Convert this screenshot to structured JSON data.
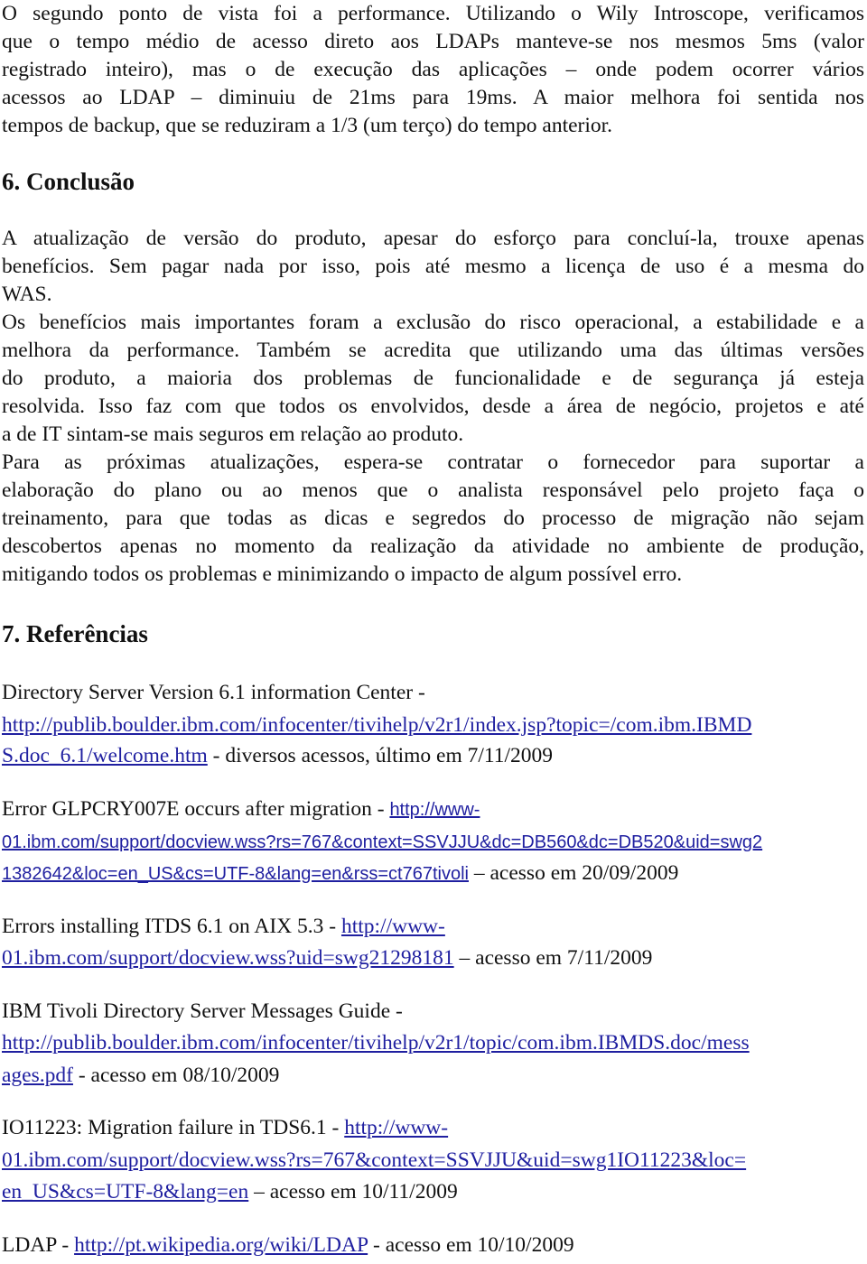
{
  "paragraph_performance": {
    "lines": [
      "O segundo ponto de vista foi a performance. Utilizando o Wily Introscope, verificamos",
      "que o tempo médio de acesso direto aos LDAPs manteve-se nos mesmos 5ms (valor",
      "registrado inteiro), mas o de execução das aplicações – onde podem ocorrer vários",
      "acessos ao LDAP – diminuiu de 21ms para 19ms. A maior melhora foi sentida nos",
      "tempos de backup, que se reduziram a 1/3 (um terço) do tempo anterior."
    ]
  },
  "section6": {
    "heading": "6. Conclusão",
    "p1_lines": [
      "A atualização de versão do produto, apesar do esforço para concluí-la, trouxe apenas",
      "benefícios. Sem pagar nada por isso, pois até mesmo a licença de uso é a mesma do",
      "WAS."
    ],
    "p2_lines": [
      "Os benefícios mais importantes foram a exclusão do risco operacional, a estabilidade e a",
      "melhora da performance. Também se acredita que utilizando uma das últimas versões",
      "do produto, a maioria dos problemas de funcionalidade e de segurança já esteja",
      "resolvida. Isso faz com que todos os envolvidos, desde a área de negócio, projetos e até",
      "a de IT sintam-se mais seguros em relação ao produto."
    ],
    "p3_lines": [
      "Para as próximas atualizações, espera-se contratar o fornecedor para suportar a",
      "elaboração do plano ou ao menos que o analista responsável pelo projeto faça o",
      "treinamento, para que todas as dicas e segredos do processo de migração não sejam",
      "descobertos apenas no momento da realização da atividade no ambiente de produção,",
      "mitigando todos os problemas e minimizando o impacto de algum possível erro."
    ]
  },
  "section7": {
    "heading": "7.  Referências",
    "references": [
      {
        "title": "Directory Server Version 6.1 information Center -",
        "link_line1": "http://publib.boulder.ibm.com/infocenter/tivihelp/v2r1/index.jsp?topic=/com.ibm.IBMD",
        "link_line2": "S.doc_6.1/welcome.htm",
        "suffix": " - diversos acessos, último em 7/11/2009"
      },
      {
        "title": "Error GLPCRY007E occurs after migration - ",
        "link_line1": "http://www-",
        "link_line2": "01.ibm.com/support/docview.wss?rs=767&context=SSVJJU&dc=DB560&dc=DB520&uid=swg2",
        "link_line3": "1382642&loc=en_US&cs=UTF-8&lang=en&rss=ct767tivoli",
        "suffix": " – acesso em 20/09/2009"
      },
      {
        "title": "Errors installing ITDS 6.1 on AIX 5.3 - ",
        "link_line1": "http://www-",
        "link_line2": "01.ibm.com/support/docview.wss?uid=swg21298181",
        "suffix": " – acesso em 7/11/2009"
      },
      {
        "title": "IBM Tivoli Directory Server Messages Guide -",
        "link_line1": "http://publib.boulder.ibm.com/infocenter/tivihelp/v2r1/topic/com.ibm.IBMDS.doc/mess",
        "link_line2": "ages.pdf",
        "suffix": " - acesso em 08/10/2009"
      },
      {
        "title": "IO11223: Migration failure in TDS6.1 - ",
        "link_line1": "http://www-",
        "link_line2": "01.ibm.com/support/docview.wss?rs=767&context=SSVJJU&uid=swg1IO11223&loc=",
        "link_line3": "en_US&cs=UTF-8&lang=en",
        "suffix": " – acesso em 10/11/2009"
      },
      {
        "title": "LDAP - ",
        "link_line1": "http://pt.wikipedia.org/wiki/LDAP",
        "suffix": " - acesso em 10/10/2009"
      }
    ]
  },
  "colors": {
    "text": "#111111",
    "link": "#1f1fa0",
    "background": "#ffffff"
  }
}
